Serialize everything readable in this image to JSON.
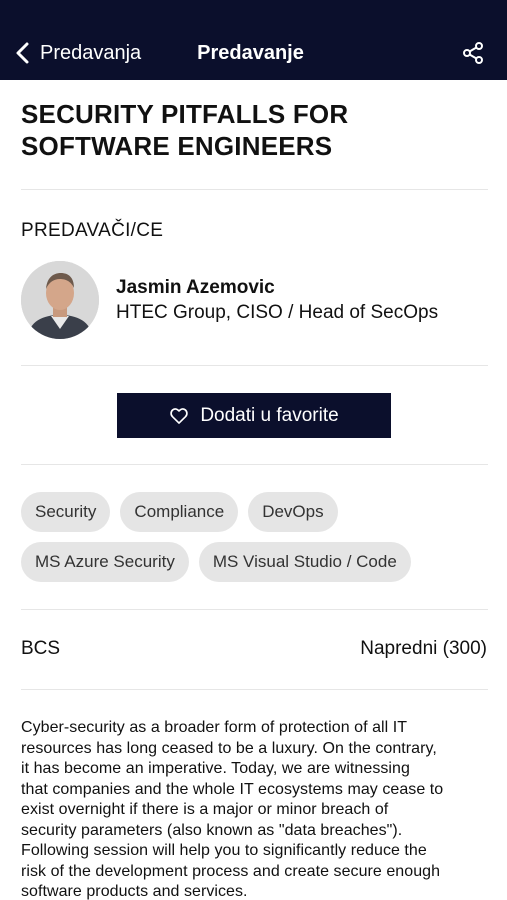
{
  "colors": {
    "nav_background": "#0b0f2c",
    "button_background": "#0b0f2c",
    "tag_background": "#e5e5e5"
  },
  "nav": {
    "back_label": "Predavanja",
    "title": "Predavanje",
    "back_icon": "chevron-left-icon",
    "share_icon": "share-icon"
  },
  "lecture": {
    "title_line1": "SECURITY PITFALLS FOR",
    "title_line2": "SOFTWARE ENGINEERS"
  },
  "speakers": {
    "section_label": "PREDAVAČI/CE",
    "items": [
      {
        "name": "Jasmin Azemovic",
        "role": "HTEC Group, CISO / Head of SecOps"
      }
    ]
  },
  "favorite": {
    "label": "Dodati u favorite",
    "icon": "heart-icon"
  },
  "tags": {
    "row1": [
      "Security",
      "Compliance",
      "DevOps"
    ],
    "row2": [
      "MS Azure Security",
      "MS Visual Studio / Code"
    ]
  },
  "info": {
    "track": "BCS",
    "level": "Napredni (300)"
  },
  "description": {
    "lines": [
      "Cyber-security as a broader form of protection of all IT",
      "resources has long ceased to be a luxury. On the contrary,",
      "it has become an imperative. Today, we are witnessing",
      "that companies and the whole IT ecosystems may cease to",
      "exist overnight if there is a major or minor breach of",
      "security parameters (also known as \"data breaches\").",
      "Following session will help you to significantly reduce the",
      "risk of the development process and create secure enough",
      "software products and services."
    ]
  }
}
